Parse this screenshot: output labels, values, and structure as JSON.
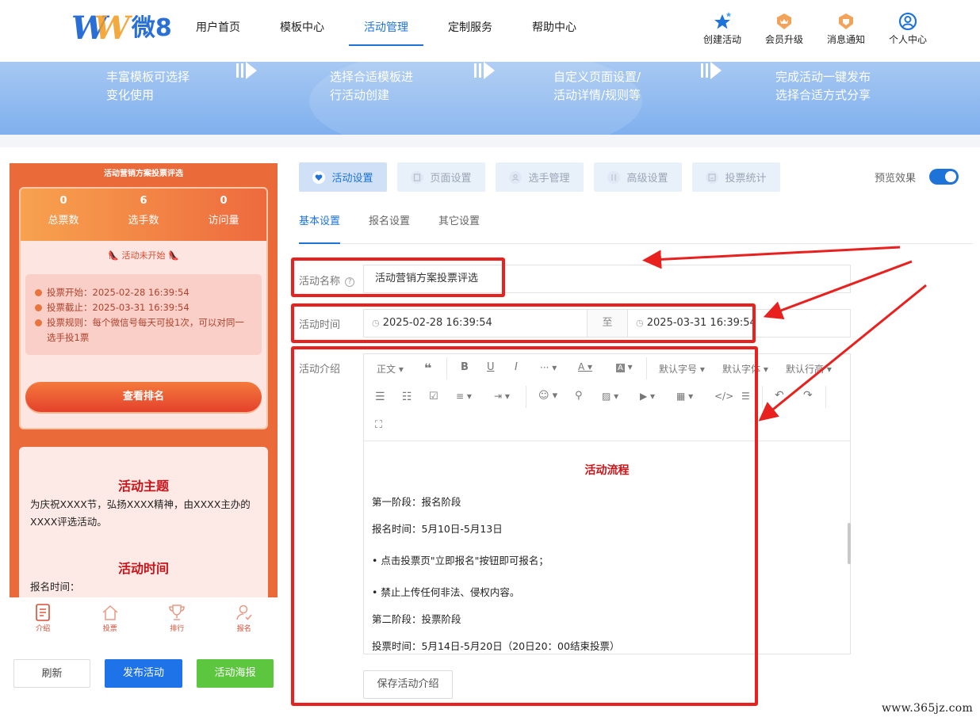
{
  "logo": {
    "mark": "W",
    "text": "微8"
  },
  "nav": {
    "items": [
      {
        "label": "用户首页"
      },
      {
        "label": "模板中心"
      },
      {
        "label": "活动管理",
        "active": true
      },
      {
        "label": "定制服务"
      },
      {
        "label": "帮助中心"
      }
    ]
  },
  "tools": {
    "create": "创建活动",
    "upgrade": "会员升级",
    "notice": "消息通知",
    "profile": "个人中心"
  },
  "banner": {
    "steps": [
      {
        "line1": "丰富模板可选择",
        "line2": "变化使用"
      },
      {
        "line1": "选择合适模板进",
        "line2": "行活动创建"
      },
      {
        "line1": "自定义页面设置/",
        "line2": "活动详情/规则等"
      },
      {
        "line1": "完成活动一键发布",
        "line2": "选择合适方式分享"
      }
    ]
  },
  "preview": {
    "title": "活动营销方案投票评选",
    "stats": [
      {
        "value": "0",
        "label": "总票数"
      },
      {
        "value": "6",
        "label": "选手数"
      },
      {
        "value": "0",
        "label": "访问量"
      }
    ],
    "status": "活动未开始",
    "vote_start": "投票开始：2025-02-28 16:39:54",
    "vote_end": "投票截止：2025-03-31 16:39:54",
    "vote_rule": "投票规则：每个微信号每天可投1次，可以对同一选手投1票",
    "rank_button": "查看排名",
    "theme_heading": "活动主题",
    "theme_text": "为庆祝XXXX节，弘扬XXXX精神，由XXXX主办的XXXX评选活动。",
    "time_heading": "活动时间",
    "time_text": "报名时间：",
    "tabs": [
      {
        "label": "介绍"
      },
      {
        "label": "投票"
      },
      {
        "label": "排行"
      },
      {
        "label": "报名"
      }
    ]
  },
  "actions": {
    "refresh": "刷新",
    "publish": "发布活动",
    "poster": "活动海报"
  },
  "settings": {
    "tabs": [
      {
        "label": "活动设置",
        "active": true
      },
      {
        "label": "页面设置"
      },
      {
        "label": "选手管理"
      },
      {
        "label": "高级设置"
      },
      {
        "label": "投票统计"
      }
    ],
    "preview_label": "预览效果",
    "preview_on": true,
    "subtabs": [
      {
        "label": "基本设置",
        "active": true
      },
      {
        "label": "报名设置"
      },
      {
        "label": "其它设置"
      }
    ],
    "name_label": "活动名称",
    "name_value": "活动营销方案投票评选",
    "time_label": "活动时间",
    "start_time": "2025-02-28 16:39:54",
    "to_label": "至",
    "end_time": "2025-03-31 16:39:54",
    "intro_label": "活动介绍",
    "save_button": "保存活动介绍"
  },
  "editor": {
    "paragraph_style": "正文",
    "font_size": "默认字号",
    "font_family": "默认字体",
    "line_height": "默认行高",
    "content": {
      "title": "活动流程",
      "paragraphs": [
        "第一阶段：报名阶段",
        "报名时间：5月10日-5月13日",
        "• 点击投票页\"立即报名\"按钮即可报名；",
        "• 禁止上传任何非法、侵权内容。",
        "第二阶段：投票阶段",
        "投票时间：5月14日-5月20日（20日20：00结束投票）"
      ]
    }
  },
  "annotation": {
    "color": "#e8201e"
  },
  "watermark": "www.365jz.com",
  "colors": {
    "accent": "#1e73d8",
    "orange": "#ea6a3a",
    "green": "#5cc63f",
    "red": "#e8201e"
  }
}
